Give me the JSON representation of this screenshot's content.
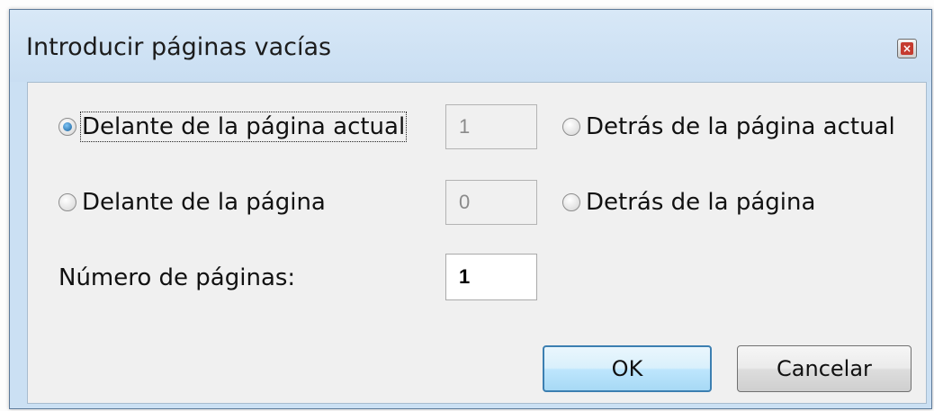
{
  "dialog": {
    "title": "Introducir páginas vacías",
    "close_glyph": "×"
  },
  "options": {
    "before_current": {
      "label": "Delante de la página actual",
      "checked": true
    },
    "after_current": {
      "label": "Detrás de la página actual",
      "checked": false
    },
    "before_page": {
      "label": "Delante de la página",
      "checked": false
    },
    "after_page": {
      "label": "Detrás de la página",
      "checked": false
    }
  },
  "fields": {
    "current_page_value": "1",
    "page_value": "0",
    "count_label": "Número de páginas:",
    "count_value": "1"
  },
  "buttons": {
    "ok": "OK",
    "cancel": "Cancelar"
  },
  "colors": {
    "frame": "#cbe0f3",
    "client": "#f0f0f0",
    "radio_selected": "#145e9a"
  }
}
